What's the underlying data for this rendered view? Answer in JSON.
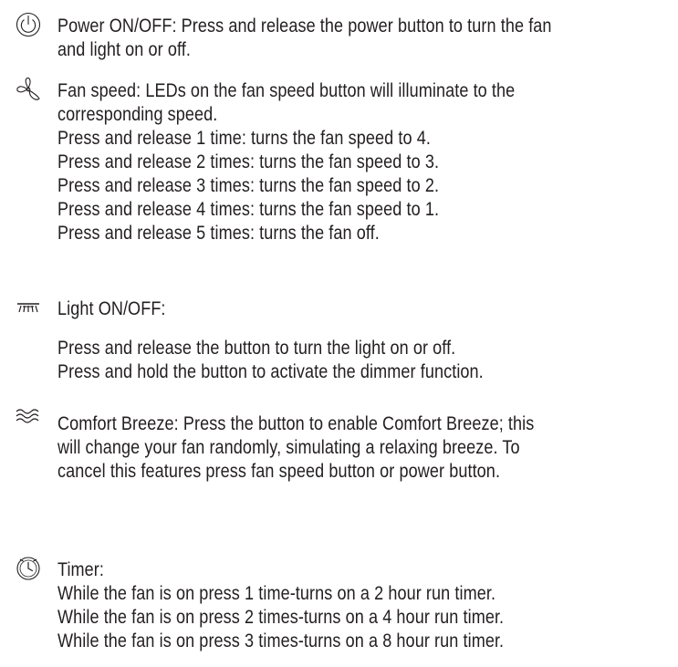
{
  "sections": [
    {
      "icon": "power-icon",
      "lines": [
        "Power ON/OFF: Press and release the power button to turn the fan",
        "and light on or off."
      ]
    },
    {
      "icon": "fan-icon",
      "lines": [
        "Fan speed: LEDs on the fan speed button will illuminate to the",
        "corresponding speed.",
        "Press and release 1 time: turns the fan speed to 4.",
        "Press and release 2 times: turns the fan speed to 3.",
        "Press and release 3 times: turns the fan speed to 2.",
        "Press and release 4 times: turns the fan speed to 1.",
        "Press and release 5 times: turns the fan off."
      ]
    },
    {
      "icon": "light-icon",
      "lines": [
        "Light ON/OFF:"
      ],
      "detail_lines": [
        "Press and release the button to turn the light on or off.",
        "Press and hold the button to activate the dimmer function."
      ]
    },
    {
      "icon": "breeze-icon",
      "lines": [
        "Comfort Breeze: Press the button to enable Comfort Breeze; this",
        "will change your fan randomly, simulating a relaxing breeze. To",
        "cancel this features press fan speed button or power button."
      ]
    },
    {
      "icon": "timer-icon",
      "lines": [
        "Timer:",
        "While the fan is on press 1 time-turns on a 2 hour run timer.",
        "While the fan is on press 2 times-turns on a 4 hour run timer.",
        "While the fan is on press 3 times-turns on a 8 hour run timer."
      ]
    }
  ]
}
